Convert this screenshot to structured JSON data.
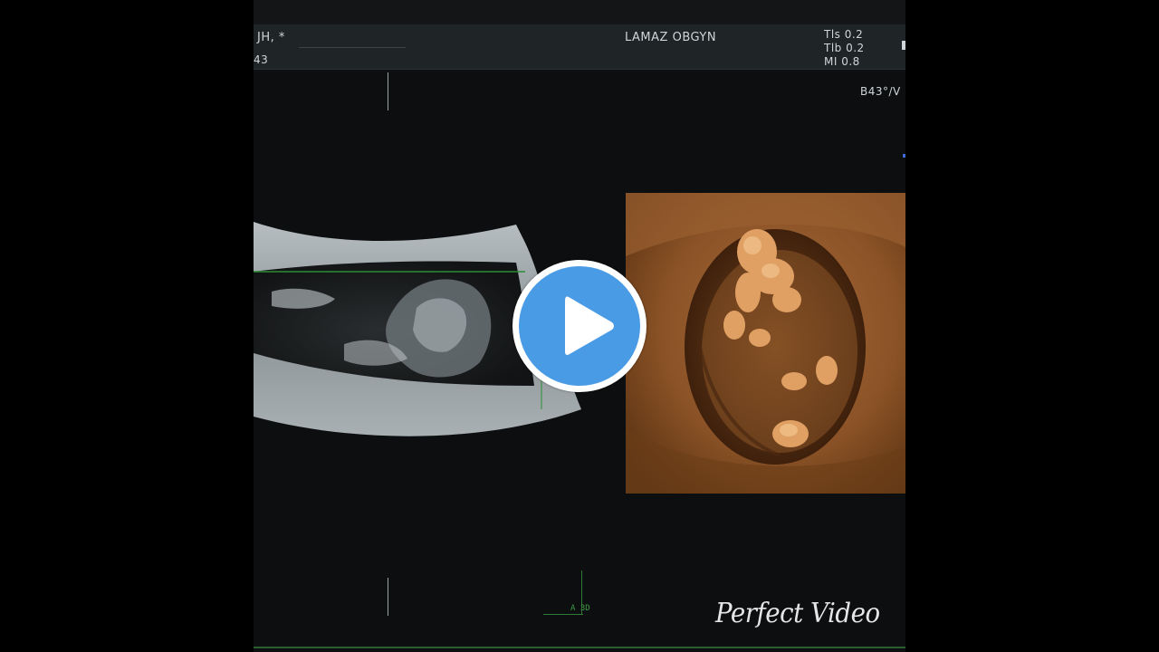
{
  "header": {
    "patient": "JH, *",
    "id": "43",
    "clinic": "LAMAZ OBGYN",
    "indices": [
      "Tls 0.2",
      "Tlb 0.2",
      "MI 0.8"
    ]
  },
  "depth_label": "B43°/V",
  "bottom_marker": "A 3D",
  "play_button": {
    "icon": "play-icon",
    "color": "#4a9be6"
  },
  "watermark": "Perfect Video"
}
